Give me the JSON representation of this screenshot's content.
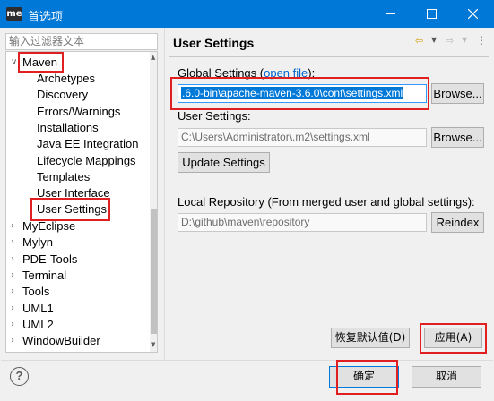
{
  "window": {
    "title": "首选项",
    "app_icon": "me"
  },
  "filter": {
    "placeholder": "输入过滤器文本"
  },
  "tree": {
    "items": [
      {
        "label": "Maven",
        "expanded": true
      },
      {
        "label": "Archetypes"
      },
      {
        "label": "Discovery"
      },
      {
        "label": "Errors/Warnings"
      },
      {
        "label": "Installations"
      },
      {
        "label": "Java EE Integration"
      },
      {
        "label": "Lifecycle Mappings"
      },
      {
        "label": "Templates"
      },
      {
        "label": "User Interface"
      },
      {
        "label": "User Settings",
        "selected": true
      },
      {
        "label": "MyEclipse"
      },
      {
        "label": "Mylyn"
      },
      {
        "label": "PDE-Tools"
      },
      {
        "label": "Terminal"
      },
      {
        "label": "Tools"
      },
      {
        "label": "UML1"
      },
      {
        "label": "UML2"
      },
      {
        "label": "WindowBuilder"
      }
    ]
  },
  "page": {
    "title": "User Settings",
    "global_label_prefix": "Global Settings (",
    "global_link": "open file",
    "global_label_suffix": "):",
    "global_value": ".6.0-bin\\apache-maven-3.6.0\\conf\\settings.xml",
    "user_label": "User Settings:",
    "user_value": "C:\\Users\\Administrator\\.m2\\settings.xml",
    "browse_label": "Browse...",
    "update_label": "Update Settings",
    "local_repo_label": "Local Repository (From merged user and global settings):",
    "local_repo_value": "D:\\github\\maven\\repository",
    "reindex_label": "Reindex"
  },
  "buttons": {
    "restore_defaults": "恢复默认值(D)",
    "apply": "应用(A)",
    "ok": "确定",
    "cancel": "取消"
  },
  "colors": {
    "titlebar": "#0078d7",
    "selection": "#0078d7",
    "highlight_box": "#e02020",
    "link": "#0066cc"
  }
}
